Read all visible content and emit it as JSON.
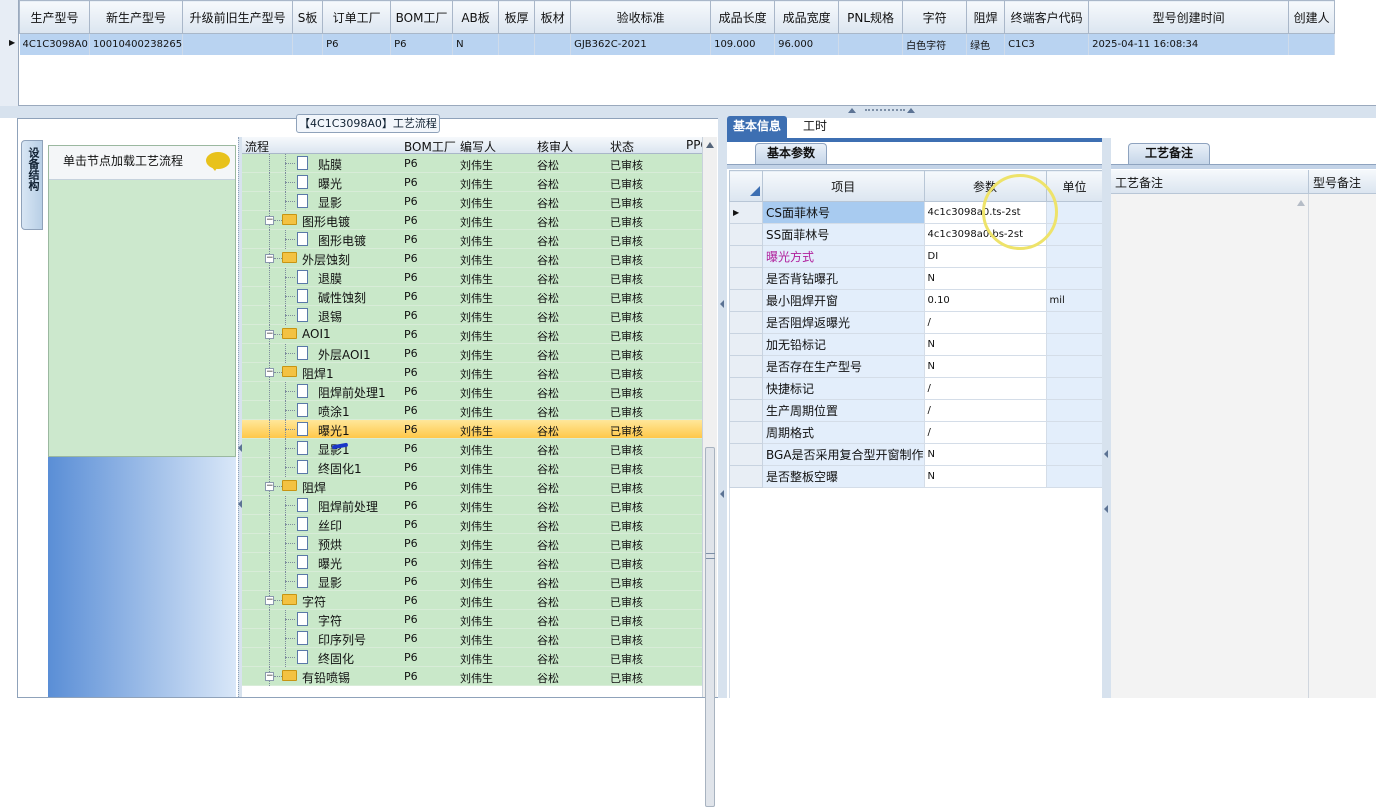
{
  "top_grid": {
    "columns": [
      "生产型号",
      "新生产型号",
      "升级前旧生产型号",
      "S板",
      "订单工厂",
      "BOM工厂",
      "AB板",
      "板厚",
      "板材",
      "验收标准",
      "成品长度",
      "成品宽度",
      "PNL规格",
      "字符",
      "阻焊",
      "终端客户代码",
      "型号创建时间",
      "创建人"
    ],
    "row": [
      "4C1C3098A0",
      "10010400238265",
      "",
      "",
      "P6",
      "P6",
      "N",
      "",
      "",
      "GJB362C-2021",
      "109.000",
      "96.000",
      "",
      "白色字符",
      "绿色",
      "C1C3",
      "2025-04-11 16:08:34",
      ""
    ]
  },
  "left_panel": {
    "title": "【4C1C3098A0】工艺流程",
    "vertical_tab": "设备结构",
    "note_text": "单击节点加载工艺流程"
  },
  "flow_grid": {
    "headers": [
      "流程",
      "BOM工厂",
      "编写人",
      "核审人",
      "状态",
      "PPC"
    ],
    "rows": [
      {
        "name": "贴膜",
        "level": 2,
        "type": "doc",
        "bom": "P6",
        "writer": "刘伟生",
        "reviewer": "谷松",
        "status": "已审核"
      },
      {
        "name": "曝光",
        "level": 2,
        "type": "doc",
        "bom": "P6",
        "writer": "刘伟生",
        "reviewer": "谷松",
        "status": "已审核"
      },
      {
        "name": "显影",
        "level": 2,
        "type": "doc",
        "bom": "P6",
        "writer": "刘伟生",
        "reviewer": "谷松",
        "status": "已审核"
      },
      {
        "name": "图形电镀",
        "level": 1,
        "type": "folder",
        "bom": "P6",
        "writer": "刘伟生",
        "reviewer": "谷松",
        "status": "已审核"
      },
      {
        "name": "图形电镀",
        "level": 2,
        "type": "doc",
        "bom": "P6",
        "writer": "刘伟生",
        "reviewer": "谷松",
        "status": "已审核"
      },
      {
        "name": "外层蚀刻",
        "level": 1,
        "type": "folder",
        "bom": "P6",
        "writer": "刘伟生",
        "reviewer": "谷松",
        "status": "已审核"
      },
      {
        "name": "退膜",
        "level": 2,
        "type": "doc",
        "bom": "P6",
        "writer": "刘伟生",
        "reviewer": "谷松",
        "status": "已审核"
      },
      {
        "name": "碱性蚀刻",
        "level": 2,
        "type": "doc",
        "bom": "P6",
        "writer": "刘伟生",
        "reviewer": "谷松",
        "status": "已审核"
      },
      {
        "name": "退锡",
        "level": 2,
        "type": "doc",
        "bom": "P6",
        "writer": "刘伟生",
        "reviewer": "谷松",
        "status": "已审核"
      },
      {
        "name": "AOI1",
        "level": 1,
        "type": "folder",
        "bom": "P6",
        "writer": "刘伟生",
        "reviewer": "谷松",
        "status": "已审核"
      },
      {
        "name": "外层AOI1",
        "level": 2,
        "type": "doc",
        "bom": "P6",
        "writer": "刘伟生",
        "reviewer": "谷松",
        "status": "已审核"
      },
      {
        "name": "阻焊1",
        "level": 1,
        "type": "folder",
        "bom": "P6",
        "writer": "刘伟生",
        "reviewer": "谷松",
        "status": "已审核"
      },
      {
        "name": "阻焊前处理1",
        "level": 2,
        "type": "doc",
        "bom": "P6",
        "writer": "刘伟生",
        "reviewer": "谷松",
        "status": "已审核"
      },
      {
        "name": "喷涂1",
        "level": 2,
        "type": "doc",
        "bom": "P6",
        "writer": "刘伟生",
        "reviewer": "谷松",
        "status": "已审核"
      },
      {
        "name": "曝光1",
        "level": 2,
        "type": "doc",
        "bom": "P6",
        "writer": "刘伟生",
        "reviewer": "谷松",
        "status": "已审核",
        "selected": true
      },
      {
        "name": "显影1",
        "level": 2,
        "type": "doc",
        "bom": "P6",
        "writer": "刘伟生",
        "reviewer": "谷松",
        "status": "已审核"
      },
      {
        "name": "终固化1",
        "level": 2,
        "type": "doc",
        "bom": "P6",
        "writer": "刘伟生",
        "reviewer": "谷松",
        "status": "已审核"
      },
      {
        "name": "阻焊",
        "level": 1,
        "type": "folder",
        "bom": "P6",
        "writer": "刘伟生",
        "reviewer": "谷松",
        "status": "已审核"
      },
      {
        "name": "阻焊前处理",
        "level": 2,
        "type": "doc",
        "bom": "P6",
        "writer": "刘伟生",
        "reviewer": "谷松",
        "status": "已审核"
      },
      {
        "name": "丝印",
        "level": 2,
        "type": "doc",
        "bom": "P6",
        "writer": "刘伟生",
        "reviewer": "谷松",
        "status": "已审核"
      },
      {
        "name": "预烘",
        "level": 2,
        "type": "doc",
        "bom": "P6",
        "writer": "刘伟生",
        "reviewer": "谷松",
        "status": "已审核"
      },
      {
        "name": "曝光",
        "level": 2,
        "type": "doc",
        "bom": "P6",
        "writer": "刘伟生",
        "reviewer": "谷松",
        "status": "已审核"
      },
      {
        "name": "显影",
        "level": 2,
        "type": "doc",
        "bom": "P6",
        "writer": "刘伟生",
        "reviewer": "谷松",
        "status": "已审核"
      },
      {
        "name": "字符",
        "level": 1,
        "type": "folder",
        "bom": "P6",
        "writer": "刘伟生",
        "reviewer": "谷松",
        "status": "已审核"
      },
      {
        "name": "字符",
        "level": 2,
        "type": "doc",
        "bom": "P6",
        "writer": "刘伟生",
        "reviewer": "谷松",
        "status": "已审核"
      },
      {
        "name": "印序列号",
        "level": 2,
        "type": "doc",
        "bom": "P6",
        "writer": "刘伟生",
        "reviewer": "谷松",
        "status": "已审核"
      },
      {
        "name": "终固化",
        "level": 2,
        "type": "doc",
        "bom": "P6",
        "writer": "刘伟生",
        "reviewer": "谷松",
        "status": "已审核"
      },
      {
        "name": "有铅喷锡",
        "level": 1,
        "type": "folder",
        "bom": "P6",
        "writer": "刘伟生",
        "reviewer": "谷松",
        "status": "已审核"
      }
    ]
  },
  "right_tabs": {
    "basic": "基本信息",
    "work_hours": "工时"
  },
  "basic_params": {
    "subtab": "基本参数",
    "headers": [
      "项目",
      "参数",
      "单位"
    ],
    "rows": [
      {
        "item": "CS面菲林号",
        "value": "4c1c3098a0.ts-2st",
        "unit": "",
        "selected": true
      },
      {
        "item": "SS面菲林号",
        "value": "4c1c3098a0.bs-2st",
        "unit": ""
      },
      {
        "item": "曝光方式",
        "value": "DI",
        "unit": "",
        "highlight": true
      },
      {
        "item": "是否背钻曝孔",
        "value": "N",
        "unit": ""
      },
      {
        "item": "最小阻焊开窗",
        "value": "0.10",
        "unit": "mil"
      },
      {
        "item": "是否阻焊返曝光",
        "value": "/",
        "unit": ""
      },
      {
        "item": "加无铅标记",
        "value": "N",
        "unit": ""
      },
      {
        "item": "是否存在生产型号",
        "value": "N",
        "unit": ""
      },
      {
        "item": "快捷标记",
        "value": "/",
        "unit": ""
      },
      {
        "item": "生产周期位置",
        "value": "/",
        "unit": ""
      },
      {
        "item": "周期格式",
        "value": "/",
        "unit": ""
      },
      {
        "item": "BGA是否采用复合型开窗制作",
        "value": "N",
        "unit": ""
      },
      {
        "item": "是否整板空曝",
        "value": "N",
        "unit": ""
      }
    ]
  },
  "remarks": {
    "tab": "工艺备注",
    "headers": [
      "工艺备注",
      "型号备注"
    ]
  },
  "colors": {
    "accent": "#3d6fb2",
    "tree_bg": "#c9e8c9",
    "selected_row": "#ffd45e",
    "highlight_text": "#b0209c"
  }
}
